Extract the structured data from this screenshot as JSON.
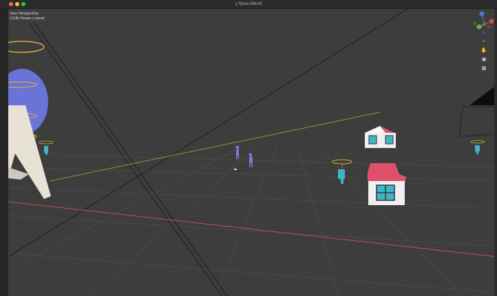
{
  "window": {
    "title": "fpwa.blend",
    "file_icon": "file-icon",
    "controls": [
      "close-button",
      "minimize-button",
      "zoom-button"
    ]
  },
  "viewport": {
    "view_mode": "User Perspective",
    "collection_info": "(118) House | camel"
  },
  "nav_gizmo": {
    "axes": [
      "Z",
      "Y",
      "X"
    ],
    "buttons": [
      "zoom-icon",
      "hand-icon",
      "camera-icon",
      "grid-icon"
    ]
  },
  "colors": {
    "viewport_bg": "#3d3d3d",
    "x_axis": "#c0505a",
    "y_axis": "#8a9a3c",
    "roof": "#e0506a",
    "window": "#3fb6c8",
    "character": "#7a7ae0",
    "character_cyan": "#3fb6c8",
    "planet": "#6a73d8",
    "ring": "#d4b23a"
  }
}
